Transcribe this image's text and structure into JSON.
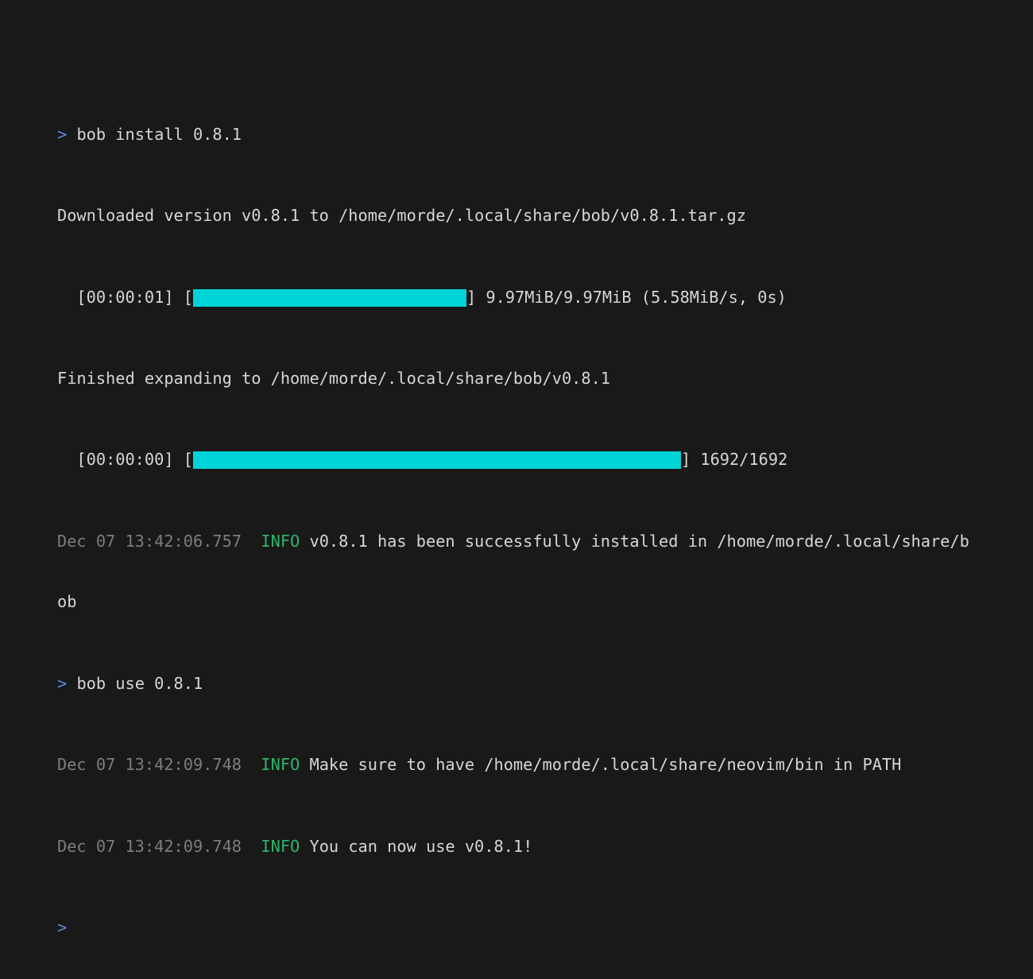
{
  "terminal": {
    "prompt_symbol": ">",
    "colors": {
      "background": "#191919",
      "text": "#d6d6d6",
      "prompt": "#5f87d7",
      "timestamp": "#7d7d7d",
      "info": "#2fb36a",
      "progress": "#00d4d8"
    },
    "lines": {
      "cmd1": "bob install 0.8.1",
      "downloaded": "Downloaded version v0.8.1 to /home/morde/.local/share/bob/v0.8.1.tar.gz",
      "progress1_time": "  [00:00:01] [",
      "progress1_stats": "] 9.97MiB/9.97MiB (5.58MiB/s, 0s)",
      "progress1_fraction": 1.0,
      "finished": "Finished expanding to /home/morde/.local/share/bob/v0.8.1",
      "progress2_time": "  [00:00:00] [",
      "progress2_stats": "] 1692/1692",
      "progress2_fraction": 1.0,
      "log1_time": "Dec 07 13:42:06.757",
      "log1_level": "INFO",
      "log1_msg": "v0.8.1 has been successfully installed in /home/morde/.local/share/b",
      "log1_wrap": "ob",
      "cmd2": "bob use 0.8.1",
      "log2_time": "Dec 07 13:42:09.748",
      "log2_level": "INFO",
      "log2_msg": "Make sure to have /home/morde/.local/share/neovim/bin in PATH",
      "log3_time": "Dec 07 13:42:09.748",
      "log3_level": "INFO",
      "log3_msg": "You can now use v0.8.1!"
    }
  }
}
